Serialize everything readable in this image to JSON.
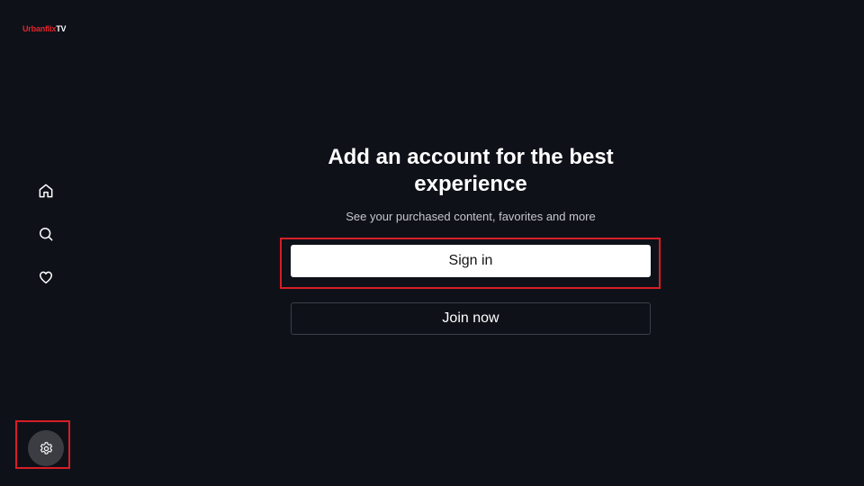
{
  "app": {
    "logo_brand": "Urbanflix",
    "logo_suffix": "TV",
    "brand_color": "#e0252a"
  },
  "sidebar": {
    "items": [
      {
        "icon": "home-icon"
      },
      {
        "icon": "search-icon"
      },
      {
        "icon": "heart-icon"
      }
    ],
    "settings": {
      "icon": "gear-icon"
    }
  },
  "main": {
    "headline": "Add an account for the best experience",
    "subtext": "See your purchased content, favorites and more",
    "signin_label": "Sign in",
    "join_label": "Join now"
  },
  "colors": {
    "background": "#0f1119",
    "focus_outline": "#d71e25"
  }
}
